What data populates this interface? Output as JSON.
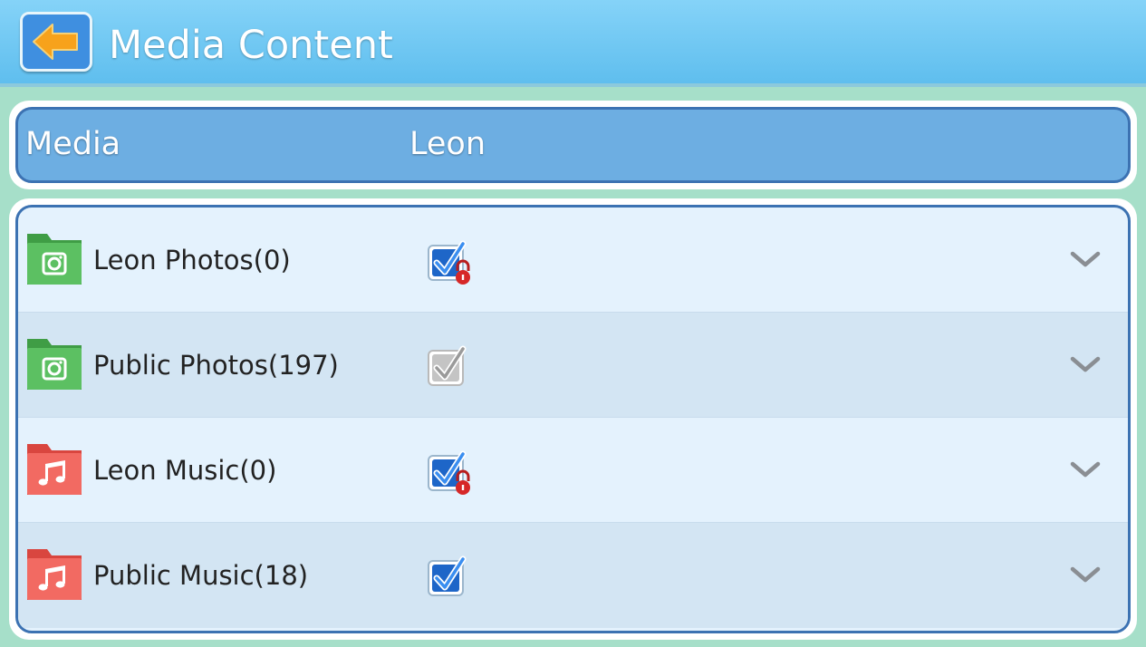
{
  "header": {
    "title": "Media Content",
    "back_icon": "arrow-left-icon"
  },
  "table_header": {
    "media_label": "Media",
    "user_label": "Leon"
  },
  "colors": {
    "topbar": "#6cc5f3",
    "background": "#a6dfc9",
    "header_blue": "#6daee2",
    "border_blue": "#3c72b2",
    "photo_folder": "#4caf50",
    "music_folder": "#f06a62",
    "checkbox_blue": "#1e66c8",
    "checkbox_gray": "#c0c0c0",
    "lock_red": "#d62828"
  },
  "items": [
    {
      "label": "Leon Photos(0)",
      "folder_icon": "photo-folder-icon",
      "checkbox": "checked-locked",
      "expand_icon": "chevron-down-icon"
    },
    {
      "label": "Public Photos(197)",
      "folder_icon": "photo-folder-icon",
      "checkbox": "checked-disabled",
      "expand_icon": "chevron-down-icon"
    },
    {
      "label": "Leon Music(0)",
      "folder_icon": "music-folder-icon",
      "checkbox": "checked-locked",
      "expand_icon": "chevron-down-icon"
    },
    {
      "label": "Public Music(18)",
      "folder_icon": "music-folder-icon",
      "checkbox": "checked",
      "expand_icon": "chevron-down-icon"
    }
  ]
}
